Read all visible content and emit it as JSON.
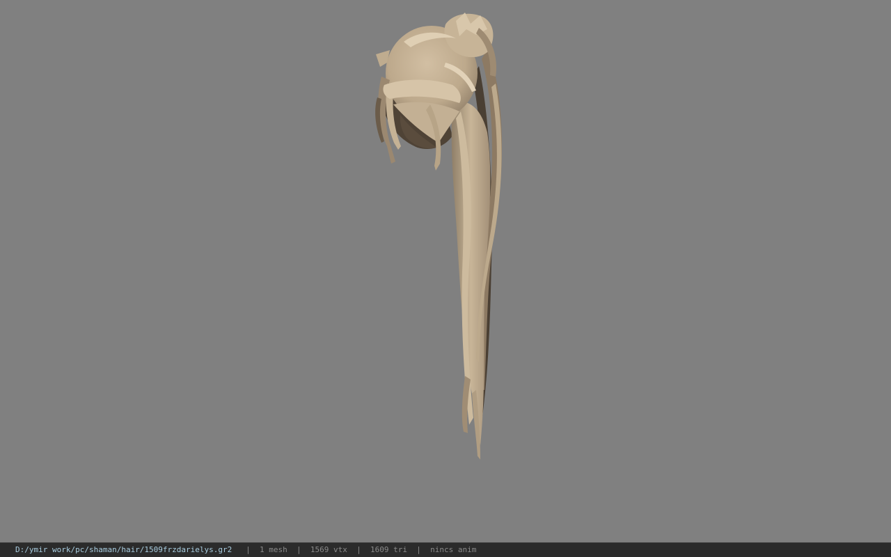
{
  "viewport": {
    "background": "#808080",
    "model_name": "hair-mesh",
    "model_colors": {
      "light": "#c9b69a",
      "mid": "#ad9a7e",
      "dark": "#5c4e3e"
    }
  },
  "statusbar": {
    "file_path": "D:/ymir work/pc/shaman/hair/1509frzdarielys.gr2",
    "separator": "|",
    "mesh_count": "1 mesh",
    "vertex_count": "1569 vtx",
    "triangle_count": "1609 tri",
    "anim_status": "nincs anim",
    "path_color": "#a9cde0",
    "text_color": "#8a8a8a"
  }
}
